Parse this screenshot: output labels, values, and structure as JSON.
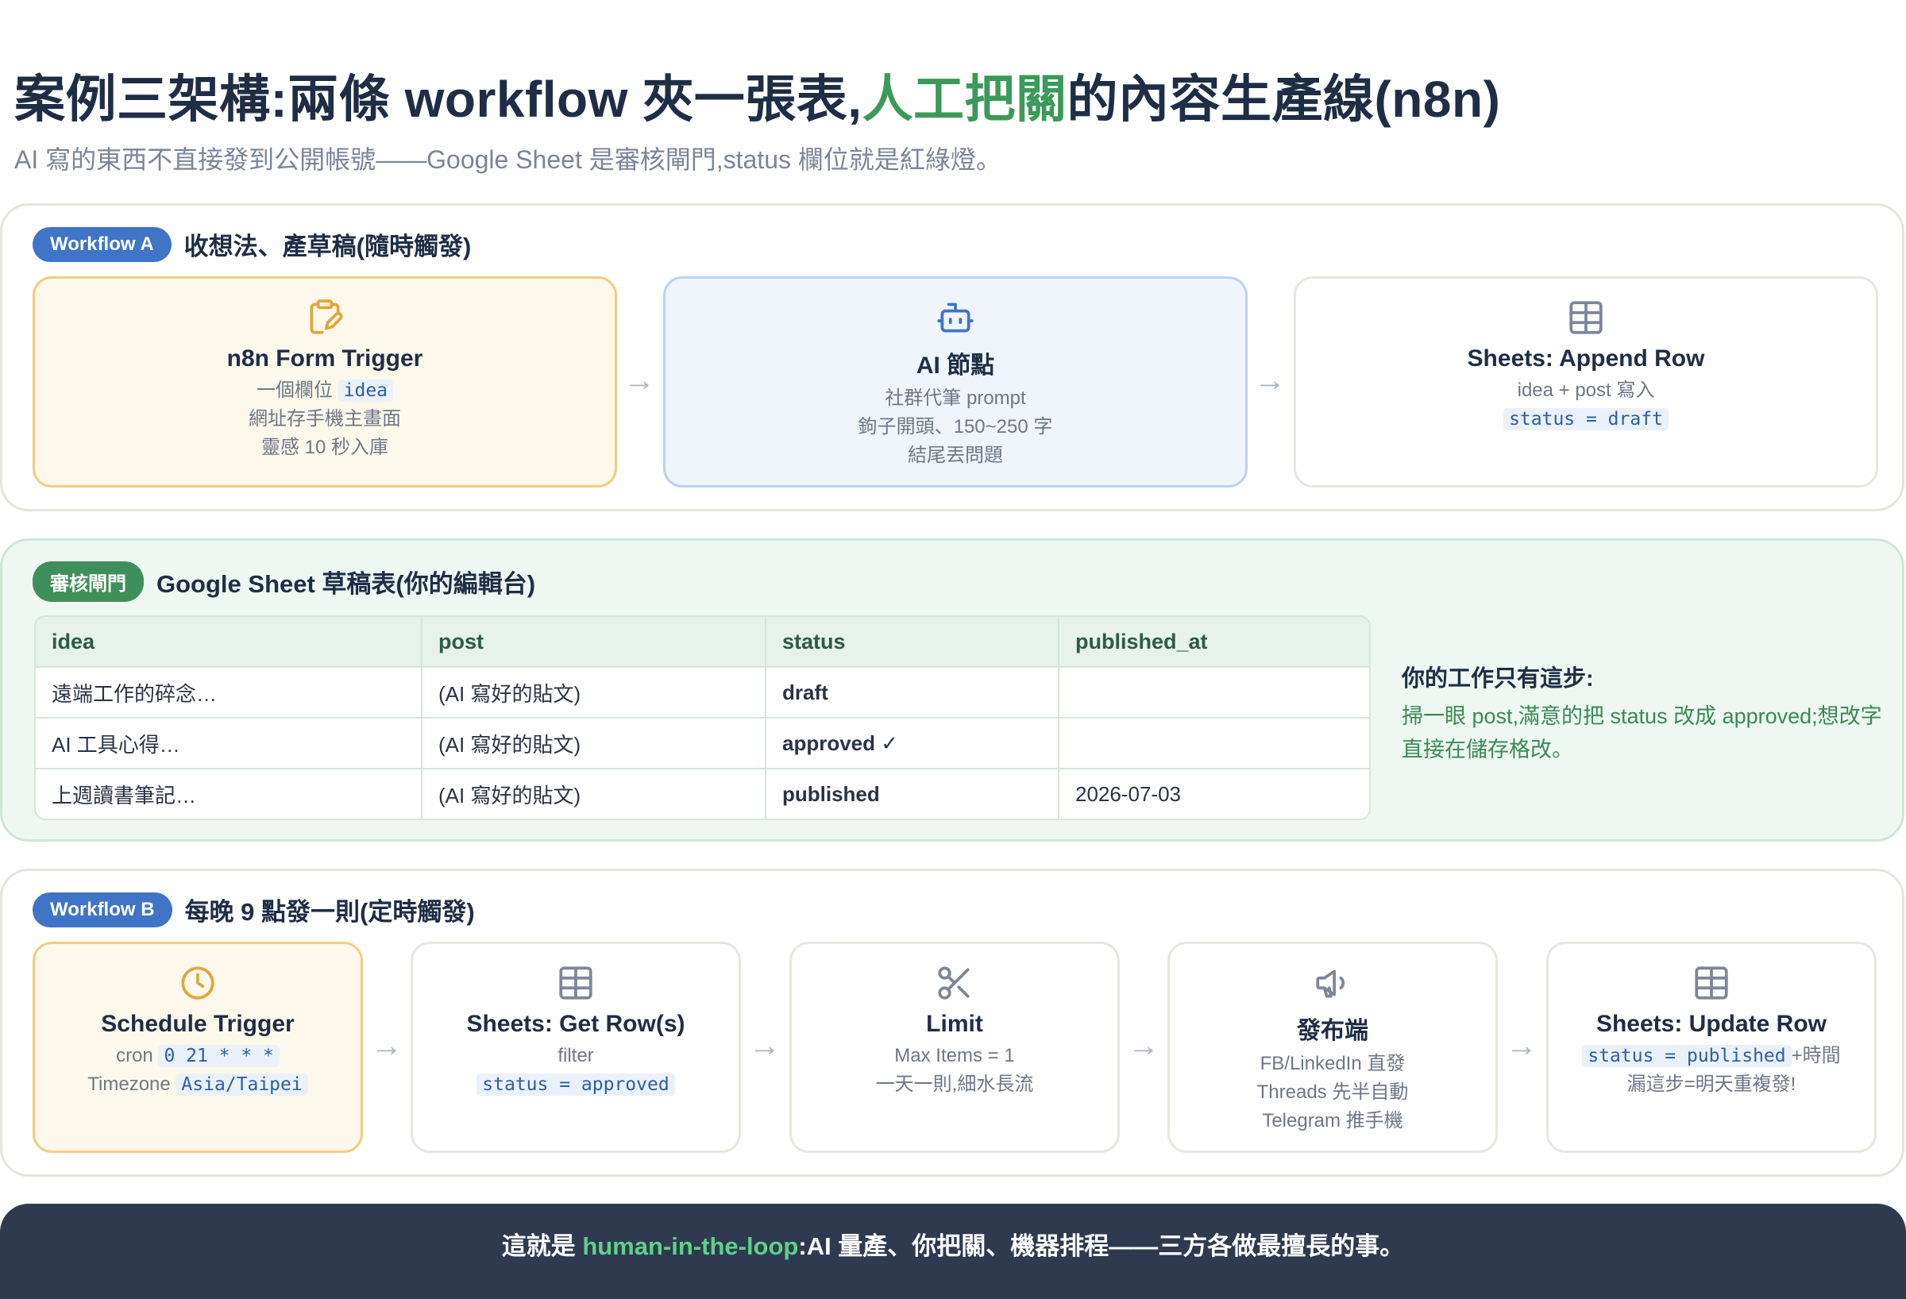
{
  "header": {
    "title_part1": "案例三架構:兩條 workflow 夾一張表,",
    "title_highlight": "人工把關",
    "title_part2": "的內容生產線(n8n)",
    "subtitle": "AI 寫的東西不直接發到公開帳號——Google Sheet 是審核閘門,status 欄位就是紅綠燈。"
  },
  "workflow_a": {
    "badge": "Workflow A",
    "title": "收想法、產草稿(隨時觸發)",
    "nodes": [
      {
        "icon": "clipboard-pen-icon",
        "name": "n8n Form Trigger",
        "line1_text": "一個欄位",
        "line1_code": "idea",
        "line2": "網址存手機主畫面",
        "line3": "靈感 10 秒入庫"
      },
      {
        "icon": "robot-icon",
        "name": "AI 節點",
        "line1": "社群代筆 prompt",
        "line2": "鉤子開頭、150~250 字",
        "line3": "結尾丟問題"
      },
      {
        "icon": "table-icon",
        "name": "Sheets: Append Row",
        "line1": "idea + post 寫入",
        "line2_code": "status = draft"
      }
    ]
  },
  "gate": {
    "badge": "審核閘門",
    "title": "Google Sheet 草稿表(你的編輯台)",
    "columns": [
      "idea",
      "post",
      "status",
      "published_at"
    ],
    "rows": [
      {
        "idea": "遠端工作的碎念…",
        "post": "(AI 寫好的貼文)",
        "status": "draft",
        "published_at": ""
      },
      {
        "idea": "AI 工具心得…",
        "post": "(AI 寫好的貼文)",
        "status": "approved ✓",
        "published_at": ""
      },
      {
        "idea": "上週讀書筆記…",
        "post": "(AI 寫好的貼文)",
        "status": "published",
        "published_at": "2026-07-03"
      }
    ],
    "note_title": "你的工作只有這步:",
    "note_body": "掃一眼 post,滿意的把 status 改成 approved;想改字直接在儲存格改。"
  },
  "workflow_b": {
    "badge": "Workflow B",
    "title": "每晚 9 點發一則(定時觸發)",
    "nodes": [
      {
        "icon": "clock-icon",
        "name": "Schedule Trigger",
        "line1_text": "cron",
        "line1_code": "0 21 * * *",
        "line2_text": "Timezone",
        "line2_code": "Asia/Taipei"
      },
      {
        "icon": "table-icon",
        "name": "Sheets: Get Row(s)",
        "line1": "filter",
        "line2_code": "status = approved"
      },
      {
        "icon": "scissors-icon",
        "name": "Limit",
        "line1": "Max Items = 1",
        "line2": "一天一則,細水長流"
      },
      {
        "icon": "megaphone-icon",
        "name": "發布端",
        "line1": "FB/LinkedIn 直發",
        "line2": "Threads 先半自動",
        "line3": "Telegram 推手機"
      },
      {
        "icon": "table-icon",
        "name": "Sheets: Update Row",
        "line1_code": "status = published",
        "line1_text": "+時間",
        "line2": "漏這步=明天重複發!"
      }
    ]
  },
  "footer": {
    "prefix": "這就是 ",
    "highlight": "human-in-the-loop",
    "suffix": ":AI 量產、你把關、機器排程——三方各做最擅長的事。"
  },
  "colors": {
    "accent_green": "#3b9a5a",
    "accent_blue": "#3f74c6",
    "trigger_yellow": "#f0cd82",
    "footer_bg": "#2f3a50"
  }
}
